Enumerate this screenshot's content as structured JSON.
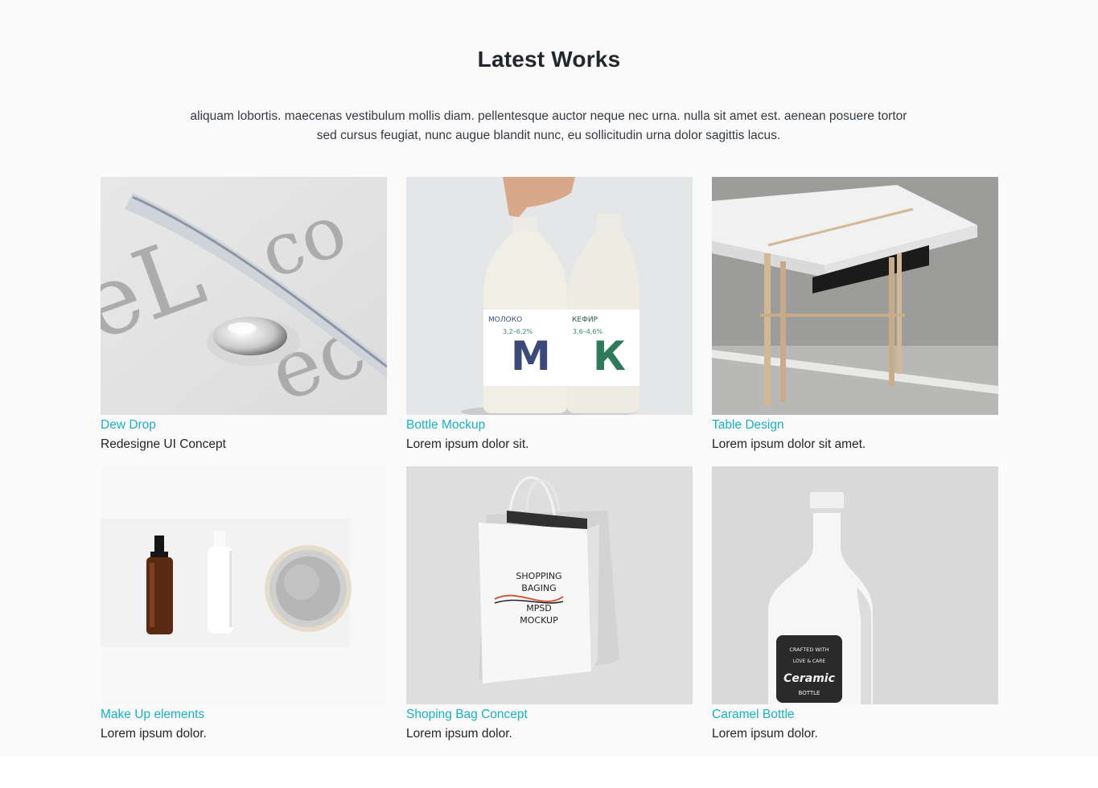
{
  "section": {
    "title": "Latest Works",
    "description": "aliquam lobortis. maecenas vestibulum mollis diam. pellentesque auctor neque nec urna. nulla sit amet est. aenean posuere tortor sed cursus feugiat, nunc augue blandit nunc, eu sollicitudin urna dolor sagittis lacus."
  },
  "colors": {
    "accent": "#18b1c4",
    "background": "#fafafa",
    "text": "#212529"
  },
  "works": [
    {
      "title": "Dew Drop",
      "subtitle": "Redesigne UI Concept",
      "image": "water-drop-typography-photo"
    },
    {
      "title": "Bottle Mockup",
      "subtitle": "Lorem ipsum dolor sit.",
      "image": "milk-bottles-photo",
      "image_text": [
        "МОЛОКО",
        "3,2–6,2%",
        "М",
        "КЕФИР",
        "3,6–4,6%",
        "К"
      ]
    },
    {
      "title": "Table Design",
      "subtitle": "Lorem ipsum dolor sit amet.",
      "image": "white-table-photo"
    },
    {
      "title": "Make Up elements",
      "subtitle": "Lorem ipsum dolor.",
      "image": "cosmetics-photo"
    },
    {
      "title": "Shoping Bag Concept",
      "subtitle": "Lorem ipsum dolor.",
      "image": "shopping-bag-photo",
      "image_text": [
        "SHOPPING",
        "BAGING",
        "MPSD",
        "MOCKUP"
      ]
    },
    {
      "title": "Caramel Bottle",
      "subtitle": "Lorem ipsum dolor.",
      "image": "ceramic-bottle-photo",
      "image_text": [
        "CRAFTED WITH",
        "LOVE & CARE",
        "Ceramic",
        "BOTTLE"
      ]
    }
  ]
}
